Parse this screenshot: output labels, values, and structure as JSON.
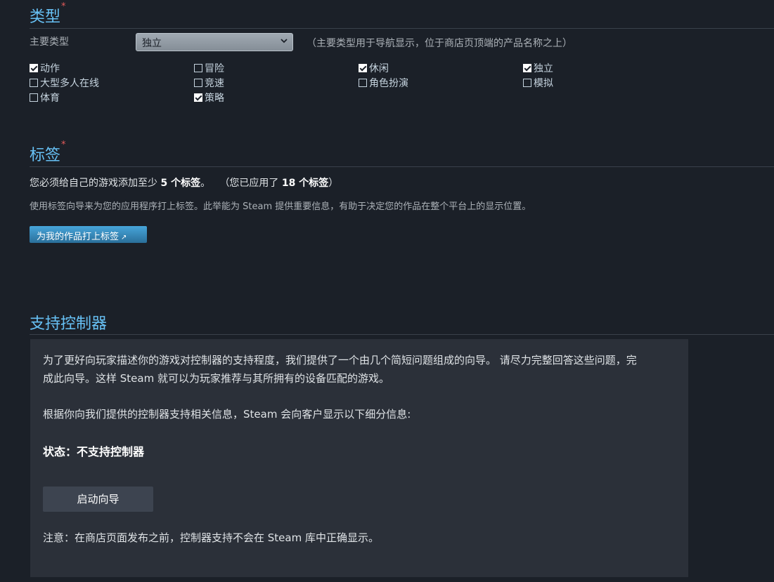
{
  "genre": {
    "title": "类型",
    "required_mark": "*",
    "primary_label": "主要类型",
    "primary_value": "独立",
    "primary_hint": "（主要类型用于导航显示，位于商店页顶端的产品名称之上）",
    "options": [
      {
        "label": "动作",
        "checked": true
      },
      {
        "label": "冒险",
        "checked": false
      },
      {
        "label": "休闲",
        "checked": true
      },
      {
        "label": "独立",
        "checked": true
      },
      {
        "label": "大型多人在线",
        "checked": false
      },
      {
        "label": "竞速",
        "checked": false
      },
      {
        "label": "角色扮演",
        "checked": false
      },
      {
        "label": "模拟",
        "checked": false
      },
      {
        "label": "体育",
        "checked": false
      },
      {
        "label": "策略",
        "checked": true
      }
    ]
  },
  "tags": {
    "title": "标签",
    "required_mark": "*",
    "min_text_a": "您必须给自己的游戏添加至少 ",
    "min_count": "5 个标签",
    "min_text_b": "。",
    "applied_text_a": "（您已应用了 ",
    "applied_count": "18 个标签",
    "applied_text_b": "）",
    "description": "使用标签向导来为您的应用程序打上标签。此举能为 Steam 提供重要信息，有助于决定您的作品在整个平台上的显示位置。",
    "button_label": "为我的作品打上标签"
  },
  "controller": {
    "title": "支持控制器",
    "intro_line1": "为了更好向玩家描述你的游戏对控制器的支持程度，我们提供了一个由几个简短问题组成的向导。 请尽力完整回答这些问题，完",
    "intro_line2": "成此向导。这样 Steam 就可以为玩家推荐与其所拥有的设备匹配的游戏。",
    "breakdown_text": "根据你向我们提供的控制器支持相关信息，Steam 会向客户显示以下细分信息:",
    "status_text": "状态：不支持控制器",
    "wizard_button": "启动向导",
    "note": "注意：在商店页面发布之前，控制器支持不会在 Steam 库中正确显示。"
  }
}
